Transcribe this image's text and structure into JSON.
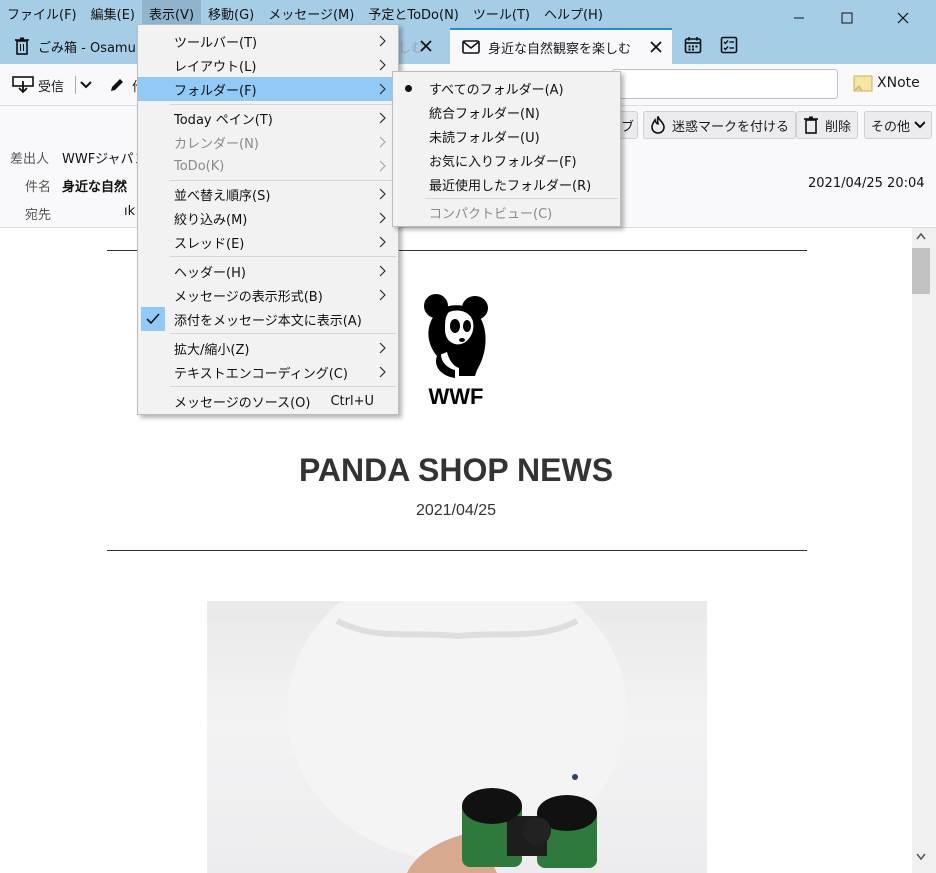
{
  "menubar": {
    "items": [
      {
        "label": "ファイル(F)"
      },
      {
        "label": "編集(E)"
      },
      {
        "label": "表示(V)"
      },
      {
        "label": "移動(G)"
      },
      {
        "label": "メッセージ(M)"
      },
      {
        "label": "予定とToDo(N)"
      },
      {
        "label": "ツール(T)"
      },
      {
        "label": "ヘルプ(H)"
      }
    ]
  },
  "tabs": {
    "inactive_label": "ごみ箱 - Osamu",
    "inactive_suffix": "しむ",
    "selected_label": "身近な自然観察を楽しむ"
  },
  "toolbar": {
    "receive_label": "受信",
    "compose_label": "作",
    "xnote_label": "XNote"
  },
  "header_buttons": {
    "archive_label": "ブ",
    "junk_label": "迷惑マークを付ける",
    "delete_label": "削除",
    "more_label": "その他"
  },
  "message_header": {
    "from_label": "差出人",
    "from_value": "WWFジャパン",
    "subject_label": "件名",
    "subject_value": "身近な自然",
    "to_label": "宛先",
    "to_value": "ık",
    "date": "2021/04/25 20:04"
  },
  "body": {
    "logo_text": "WWF",
    "title": "PANDA SHOP NEWS",
    "date": "2021/04/25"
  },
  "view_menu": {
    "items": [
      {
        "label": "ツールバー(T)"
      },
      {
        "label": "レイアウト(L)"
      },
      {
        "label": "フォルダー(F)"
      },
      {
        "label": "Today ペイン(T)"
      },
      {
        "label": "カレンダー(N)"
      },
      {
        "label": "ToDo(K)"
      },
      {
        "label": "並べ替え順序(S)"
      },
      {
        "label": "絞り込み(M)"
      },
      {
        "label": "スレッド(E)"
      },
      {
        "label": "ヘッダー(H)"
      },
      {
        "label": "メッセージの表示形式(B)"
      },
      {
        "label": "添付をメッセージ本文に表示(A)"
      },
      {
        "label": "拡大/縮小(Z)"
      },
      {
        "label": "テキストエンコーディング(C)"
      },
      {
        "label": "メッセージのソース(O)",
        "shortcut": "Ctrl+U"
      }
    ]
  },
  "folder_submenu": {
    "items": [
      {
        "label": "すべてのフォルダー(A)"
      },
      {
        "label": "統合フォルダー(N)"
      },
      {
        "label": "未読フォルダー(U)"
      },
      {
        "label": "お気に入りフォルダー(F)"
      },
      {
        "label": "最近使用したフォルダー(R)"
      },
      {
        "label": "コンパクトビュー(C)"
      }
    ]
  },
  "colors": {
    "titlebar": "#a6cde6",
    "menu_highlight": "#91c9f7",
    "tab_accent": "#2a8ad4"
  }
}
